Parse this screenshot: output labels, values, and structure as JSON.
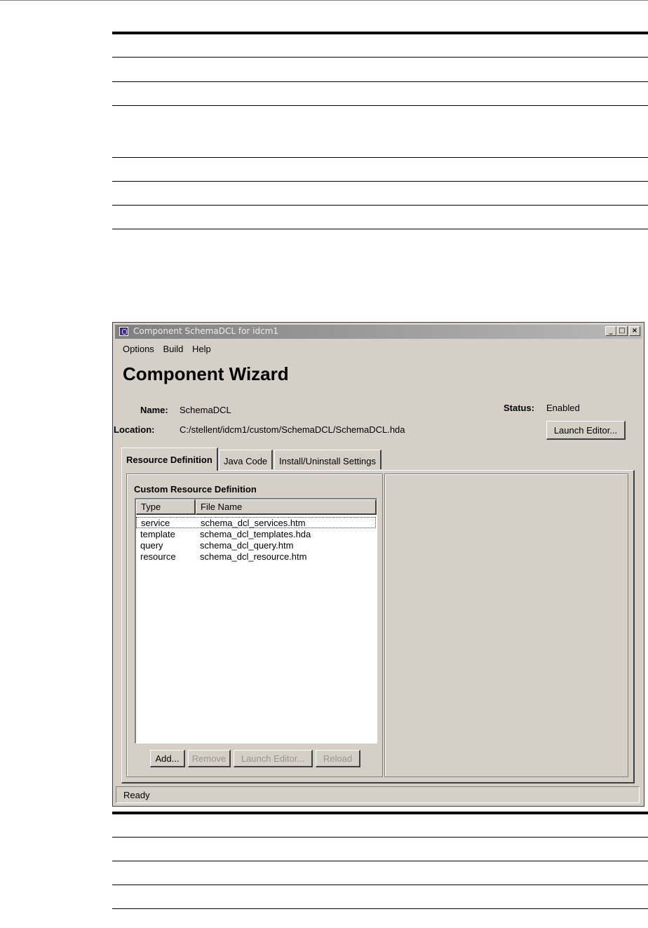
{
  "window": {
    "title": "Component SchemaDCL for idcm1",
    "controls": {
      "minimize": "_",
      "maximize": "□",
      "close": "×"
    }
  },
  "menu": {
    "items": [
      "Options",
      "Build",
      "Help"
    ]
  },
  "heading": "Component Wizard",
  "info": {
    "name_label": "Name:",
    "name_value": "SchemaDCL",
    "location_label": "Location:",
    "location_value": "C:/stellent/idcm1/custom/SchemaDCL/SchemaDCL.hda",
    "status_label": "Status:",
    "status_value": "Enabled",
    "launch_editor_label": "Launch Editor..."
  },
  "tabs": [
    "Resource Definition",
    "Java Code",
    "Install/Uninstall Settings"
  ],
  "active_tab": "Resource Definition",
  "resource_panel": {
    "group_title": "Custom Resource Definition",
    "columns": [
      "Type",
      "File Name"
    ],
    "rows": [
      {
        "type": "service",
        "file": "schema_dcl_services.htm"
      },
      {
        "type": "template",
        "file": "schema_dcl_templates.hda"
      },
      {
        "type": "query",
        "file": "schema_dcl_query.htm"
      },
      {
        "type": "resource",
        "file": "schema_dcl_resource.htm"
      }
    ],
    "buttons": {
      "add": "Add...",
      "remove": "Remove",
      "launch_editor": "Launch Editor...",
      "reload": "Reload"
    }
  },
  "status_bar": "Ready",
  "colors": {
    "window_bg": "#d4d0c8",
    "title_gradient_start": "#808080",
    "title_gradient_end": "#b8b8b8",
    "disabled_text": "#9a968e"
  }
}
